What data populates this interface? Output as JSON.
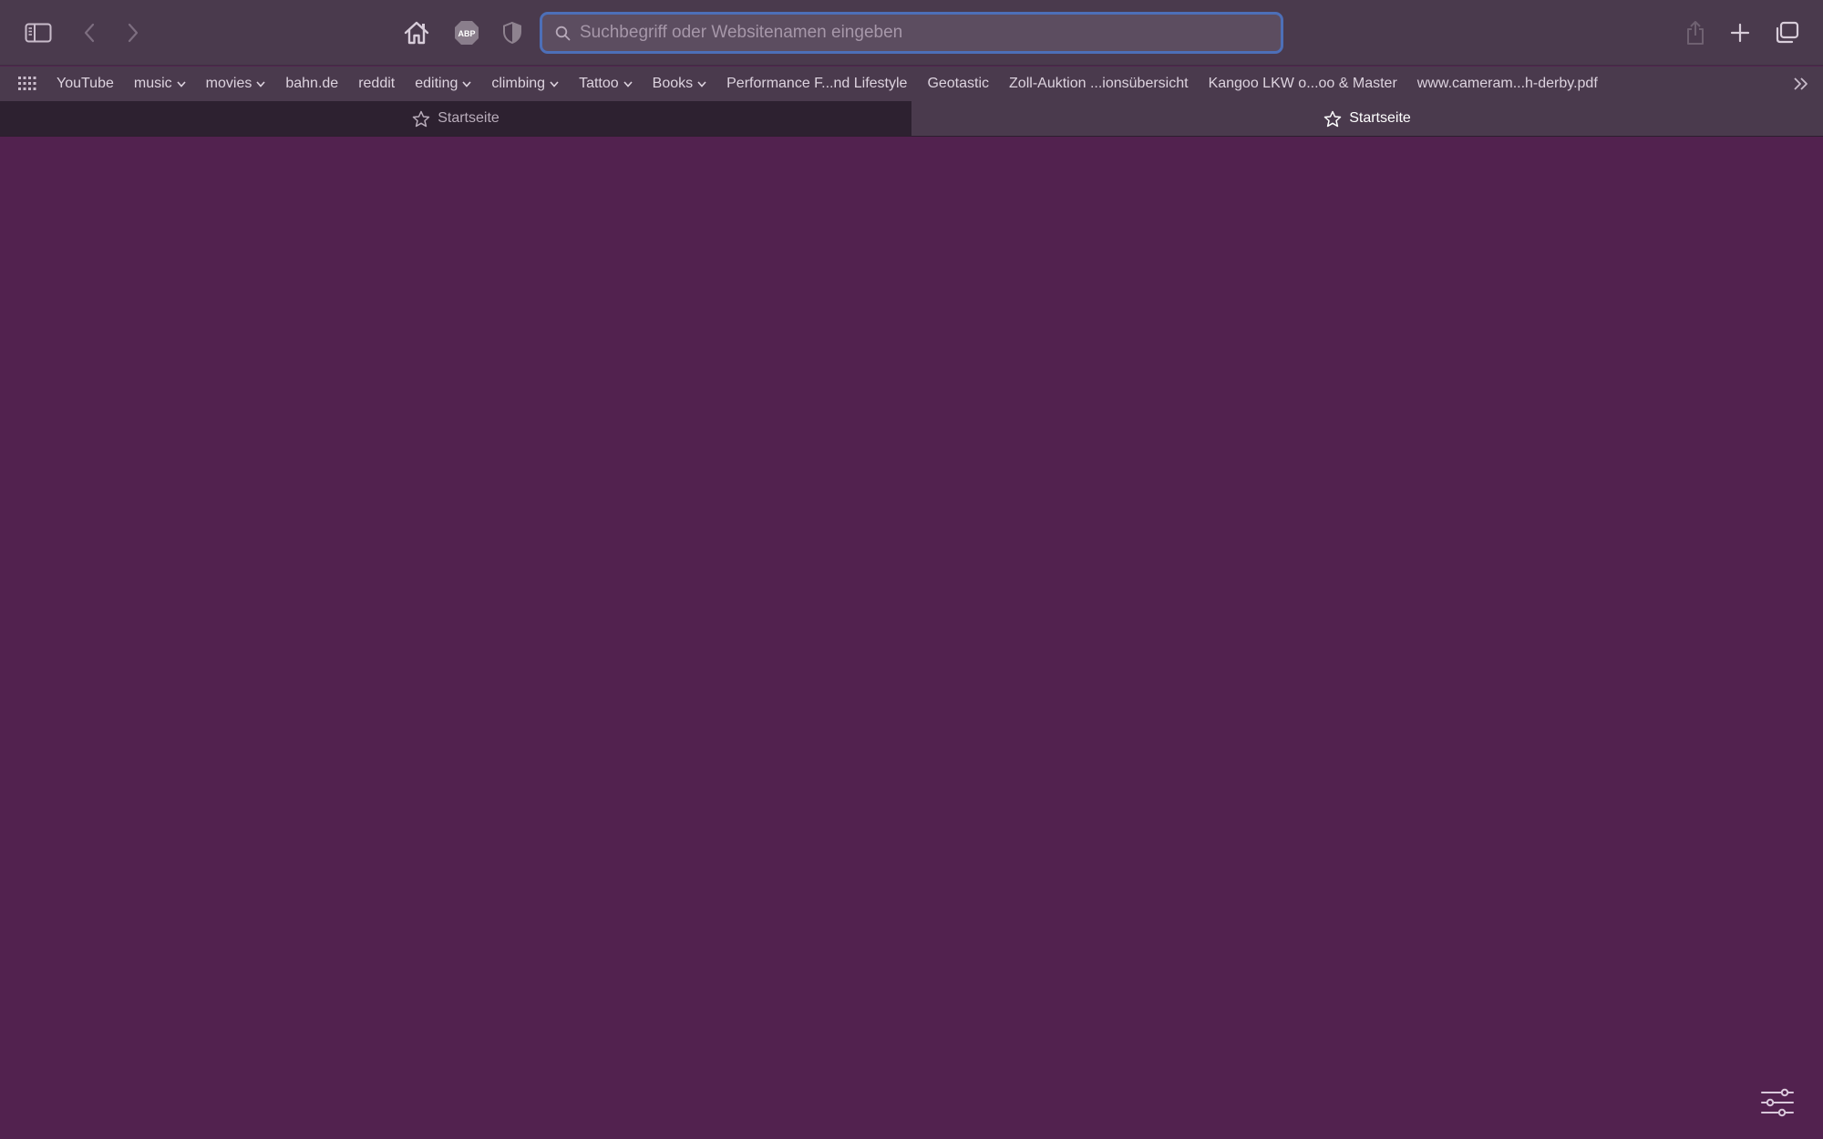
{
  "toolbar": {
    "sidebar_icon": "sidebar-icon",
    "back_icon": "chevron-left-icon",
    "forward_icon": "chevron-right-icon",
    "home_icon": "home-icon",
    "adblock_label": "ABP",
    "privacy_icon": "shield-icon",
    "share_icon": "share-icon",
    "new_tab_icon": "plus-icon",
    "tab_overview_icon": "tabs-overview-icon"
  },
  "address_bar": {
    "placeholder": "Suchbegriff oder Websitenamen eingeben",
    "value": ""
  },
  "favorites": {
    "items": [
      {
        "label": "YouTube",
        "has_menu": false
      },
      {
        "label": "music",
        "has_menu": true
      },
      {
        "label": "movies",
        "has_menu": true
      },
      {
        "label": "bahn.de",
        "has_menu": false
      },
      {
        "label": "reddit",
        "has_menu": false
      },
      {
        "label": "editing",
        "has_menu": true
      },
      {
        "label": "climbing",
        "has_menu": true
      },
      {
        "label": "Tattoo",
        "has_menu": true
      },
      {
        "label": "Books",
        "has_menu": true
      },
      {
        "label": "Performance F...nd Lifestyle",
        "has_menu": false
      },
      {
        "label": "Geotastic",
        "has_menu": false
      },
      {
        "label": "Zoll-Auktion ...ionsübersicht",
        "has_menu": false
      },
      {
        "label": "Kangoo LKW o...oo & Master",
        "has_menu": false
      },
      {
        "label": "www.cameram...h-derby.pdf",
        "has_menu": false
      }
    ]
  },
  "tabs": [
    {
      "label": "Startseite",
      "active": false
    },
    {
      "label": "Startseite",
      "active": true
    }
  ],
  "colors": {
    "page_background": "#52224f",
    "toolbar_background": "#4a3a4d",
    "address_focus_ring": "#4d6fb8",
    "inactive_tab": "#2d2130"
  },
  "content": {
    "customize_icon": "sliders-icon"
  }
}
